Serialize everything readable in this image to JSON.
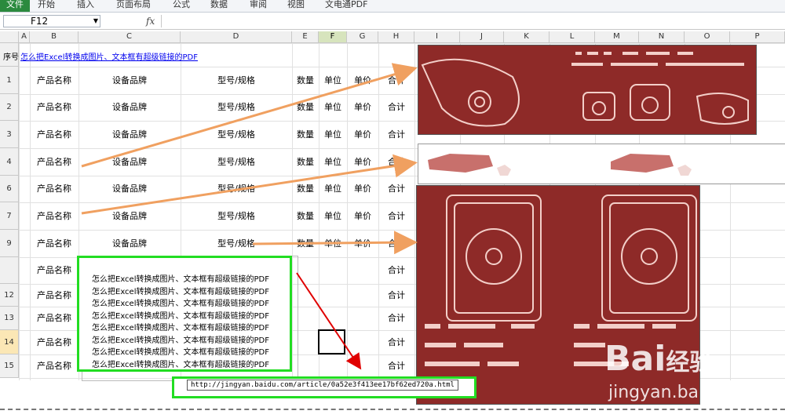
{
  "ribbon": {
    "tabs": [
      "文件",
      "开始",
      "插入",
      "页面布局",
      "公式",
      "数据",
      "审阅",
      "视图",
      "文电通PDF"
    ]
  },
  "formula_bar": {
    "name_box": "F12",
    "fx": "fx",
    "content": ""
  },
  "columns": [
    "A",
    "B",
    "C",
    "D",
    "E",
    "F",
    "G",
    "H",
    "I",
    "J",
    "K",
    "L",
    "M",
    "N",
    "O",
    "P"
  ],
  "header_row": {
    "seq": "序号",
    "link": "怎么把Excel转换成图片、文本框有超级链接的PDF"
  },
  "rows": [
    {
      "num": "1",
      "name": "产品名称",
      "brand": "设备品牌",
      "model": "型号/规格",
      "qty": "数量",
      "unit": "单位",
      "price": "单价",
      "total": "合计"
    },
    {
      "num": "2",
      "name": "产品名称",
      "brand": "设备品牌",
      "model": "型号/规格",
      "qty": "数量",
      "unit": "单位",
      "price": "单价",
      "total": "合计"
    },
    {
      "num": "3",
      "name": "产品名称",
      "brand": "设备品牌",
      "model": "型号/规格",
      "qty": "数量",
      "unit": "单位",
      "price": "单价",
      "total": "合计"
    },
    {
      "num": "4",
      "name": "产品名称",
      "brand": "设备品牌",
      "model": "型号/规格",
      "qty": "数量",
      "unit": "单位",
      "price": "单价",
      "total": "合计"
    },
    {
      "num": "6",
      "name": "产品名称",
      "brand": "设备品牌",
      "model": "型号/规格",
      "qty": "数量",
      "unit": "单位",
      "price": "单价",
      "total": "合计"
    },
    {
      "num": "7",
      "name": "产品名称",
      "brand": "设备品牌",
      "model": "型号/规格",
      "qty": "数量",
      "unit": "单位",
      "price": "单价",
      "total": "合计"
    },
    {
      "num": "9",
      "name": "产品名称",
      "brand": "设备品牌",
      "model": "型号/规格",
      "qty": "数量",
      "unit": "单位",
      "price": "单价",
      "total": "合计"
    },
    {
      "num": "",
      "name": "产品名称",
      "brand": "",
      "model": "",
      "qty": "",
      "unit": "",
      "price": "",
      "total": "合计"
    },
    {
      "num": "12",
      "name": "产品名称",
      "brand": "",
      "model": "",
      "qty": "",
      "unit": "",
      "price": "",
      "total": "合计"
    },
    {
      "num": "13",
      "name": "产品名称",
      "brand": "",
      "model": "",
      "qty": "",
      "unit": "",
      "price": "",
      "total": "合计"
    },
    {
      "num": "14",
      "name": "产品名称",
      "brand": "",
      "model": "",
      "qty": "",
      "unit": "",
      "price": "",
      "total": "合计"
    },
    {
      "num": "15",
      "name": "产品名称",
      "brand": "",
      "model": "",
      "qty": "",
      "unit": "",
      "price": "",
      "total": "合计"
    }
  ],
  "textbox_lines": [
    "怎么把Excel转换成图片、文本框有超级链接的PDF",
    "怎么把Excel转换成图片、文本框有超级链接的PDF",
    "怎么把Excel转换成图片、文本框有超级链接的PDF",
    "怎么把Excel转换成图片、文本框有超级链接的PDF",
    "怎么把Excel转换成图片、文本框有超级链接的PDF",
    "怎么把Excel转换成图片、文本框有超级链接的PDF",
    "怎么把Excel转换成图片、文本框有超级链接的PDF",
    "怎么把Excel转换成图片、文本框有超级链接的PDF"
  ],
  "hyperlink_tooltip": "http://jingyan.baidu.com/article/0a52e3f413ee17bf62ed720a.html",
  "watermark": {
    "logo": "Bai",
    "logo_cn": "经验",
    "site": "jingyan.baidu.com"
  },
  "colors": {
    "accent_green": "#22dd22",
    "arrow_orange": "#f0a060",
    "arrow_red": "#e00000",
    "image_red": "#8e2a28"
  }
}
